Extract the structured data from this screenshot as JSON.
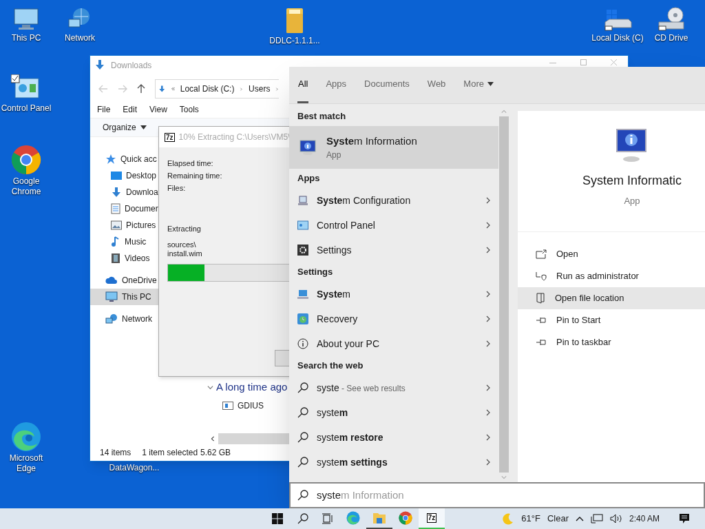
{
  "desktop_icons": [
    {
      "label": "This PC",
      "kind": "pc"
    },
    {
      "label": "Network",
      "kind": "network"
    },
    {
      "label": "DDLC-1.1.1...",
      "kind": "folder"
    },
    {
      "label": "Local Disk (C)",
      "kind": "disk"
    },
    {
      "label": "CD Drive",
      "kind": "cd"
    },
    {
      "label": "Control Panel",
      "kind": "control"
    },
    {
      "label": "Google Chrome",
      "kind": "chrome"
    },
    {
      "label": "Microsoft Edge",
      "kind": "edge"
    },
    {
      "label": "DataWagon...",
      "kind": "none"
    }
  ],
  "explorer": {
    "title": "Downloads",
    "path": [
      "Local Disk (C:)",
      "Users"
    ],
    "menu": [
      "File",
      "Edit",
      "View",
      "Tools"
    ],
    "organize": "Organize",
    "nav": [
      {
        "label": "Quick acc",
        "kind": "star",
        "selected": false
      },
      {
        "label": "Desktop",
        "kind": "desktop",
        "selected": false
      },
      {
        "label": "Downloa",
        "kind": "download",
        "selected": false
      },
      {
        "label": "Documer",
        "kind": "document",
        "selected": false
      },
      {
        "label": "Pictures",
        "kind": "pictures",
        "selected": false
      },
      {
        "label": "Music",
        "kind": "music",
        "selected": false
      },
      {
        "label": "Videos",
        "kind": "videos",
        "selected": false
      },
      {
        "label": "OneDrive",
        "kind": "cloud",
        "selected": false
      },
      {
        "label": "This PC",
        "kind": "pc",
        "selected": true
      },
      {
        "label": "Network",
        "kind": "network",
        "selected": false
      }
    ],
    "group": "A long time ago",
    "files": [
      "GDIUS"
    ],
    "status": [
      "14 items",
      "1 item selected",
      "5.62 GB"
    ]
  },
  "extract_dialog": {
    "icon_text": "7z",
    "title": "10% Extracting C:\\Users\\VM5\\",
    "labels": [
      "Elapsed time:",
      "Remaining time:",
      "Files:"
    ],
    "action": "Extracting",
    "file_lines": [
      "sources\\",
      "install.wim"
    ],
    "level": 0.1
  },
  "search": {
    "tabs": [
      {
        "label": "All",
        "selected": true
      },
      {
        "label": "Apps",
        "selected": false
      },
      {
        "label": "Documents",
        "selected": false
      },
      {
        "label": "Web",
        "selected": false
      },
      {
        "label": "More",
        "selected": false
      }
    ],
    "sections": [
      {
        "heading": "Best match",
        "items": [
          {
            "kind": "sysinfo",
            "title": "**Syste**m Information",
            "subtitle": "App",
            "selected": true
          }
        ]
      },
      {
        "heading": "Apps",
        "items": [
          {
            "kind": "msconfig",
            "title": "**Syste**m Configuration",
            "selected": false
          },
          {
            "kind": "controlpanel",
            "title": "Control Panel",
            "selected": false
          },
          {
            "kind": "gear",
            "title": "Settings",
            "selected": false
          }
        ]
      },
      {
        "heading": "Settings",
        "items": [
          {
            "kind": "system",
            "title": "**Syste**m",
            "selected": false
          },
          {
            "kind": "recovery",
            "title": "Recovery",
            "selected": false
          },
          {
            "kind": "info",
            "title": "About your PC",
            "selected": false
          }
        ]
      },
      {
        "heading": "Search the web",
        "items": [
          {
            "kind": "web",
            "title": "syste",
            "hint": "- See web results",
            "selected": false
          },
          {
            "kind": "web",
            "title": "syste**m**",
            "selected": false
          },
          {
            "kind": "web",
            "title": "syste**m restore**",
            "selected": false
          },
          {
            "kind": "web",
            "title": "syste**m settings**",
            "selected": false
          }
        ]
      }
    ],
    "detail": {
      "title": "System Informatic",
      "subtitle": "App",
      "actions": [
        {
          "label": "Open",
          "kind": "open",
          "selected": false
        },
        {
          "label": "Run as administrator",
          "kind": "admin",
          "selected": false
        },
        {
          "label": "Open file location",
          "kind": "location",
          "selected": true
        },
        {
          "label": "Pin to Start",
          "kind": "pin",
          "selected": false
        },
        {
          "label": "Pin to taskbar",
          "kind": "pin",
          "selected": false
        }
      ]
    },
    "query": "syste",
    "autocomplete": "m Information"
  },
  "taskbar": {
    "apps": [
      {
        "kind": "edge",
        "running": false,
        "selected": false
      },
      {
        "kind": "explorer",
        "running": true,
        "selected": false
      },
      {
        "kind": "chrome",
        "running": false,
        "selected": false
      },
      {
        "kind": "archiver",
        "label": "7z",
        "running": true,
        "selected": true
      }
    ],
    "temperature": "61°F",
    "condition": "Clear",
    "time": "2:40 AM"
  }
}
